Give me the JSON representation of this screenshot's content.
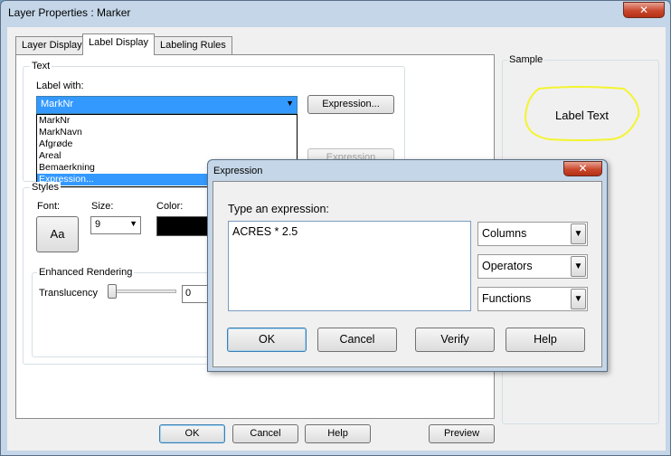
{
  "window": {
    "title": "Layer Properties  : Marker",
    "close": "✕"
  },
  "tabs": [
    "Layer Display",
    "Label Display",
    "Labeling Rules"
  ],
  "text_group": {
    "title": "Text",
    "label_with": "Label with:",
    "selected": "MarkNr",
    "expression_button": "Expression...",
    "dropdown_items": [
      "MarkNr",
      "MarkNavn",
      "Afgrøde",
      "Areal",
      "Bemaerkning",
      "Expression..."
    ],
    "disabled_button": "Expression"
  },
  "styles_group": {
    "title": "Styles",
    "font_label": "Font:",
    "font_button": "Aa",
    "size_label": "Size:",
    "size_value": "9",
    "color_label": "Color:",
    "color_value": "#000000"
  },
  "enhanced": {
    "title": "Enhanced Rendering",
    "translucency_label": "Translucency",
    "translucency_value": "0"
  },
  "sample": {
    "title": "Sample",
    "text": "Label Text"
  },
  "bottom_buttons": {
    "ok": "OK",
    "cancel": "Cancel",
    "help": "Help",
    "preview": "Preview"
  },
  "expression_dialog": {
    "title": "Expression",
    "close": "✕",
    "prompt": "Type an expression:",
    "expression": "ACRES * 2.5",
    "columns": "Columns",
    "operators": "Operators",
    "functions": "Functions",
    "ok": "OK",
    "cancel": "Cancel",
    "verify": "Verify",
    "help": "Help"
  }
}
